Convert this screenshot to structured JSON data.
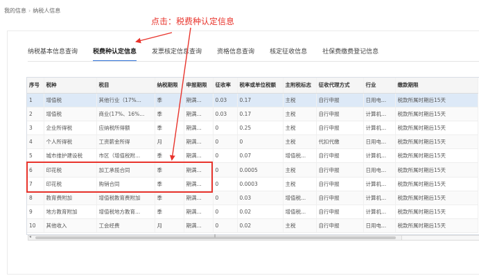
{
  "breadcrumb": {
    "root": "我的信息",
    "separator": "›",
    "current": "纳税人信息"
  },
  "annotation": {
    "text": "点击：税费种认定信息",
    "color": "#e8332b"
  },
  "tabs": [
    {
      "label": "纳税基本信息查询",
      "active": false
    },
    {
      "label": "税费种认定信息",
      "active": true
    },
    {
      "label": "发票核定信息查询",
      "active": false
    },
    {
      "label": "资格信息查询",
      "active": false
    },
    {
      "label": "核定征收信息",
      "active": false
    },
    {
      "label": "社保费缴费登记信息",
      "active": false
    }
  ],
  "table": {
    "headers": [
      "序号",
      "税种",
      "税目",
      "纳税期限",
      "申报期限",
      "征收率",
      "税率或单位税额",
      "主附税标志",
      "征收代理方式",
      "行业",
      "缴款期限"
    ],
    "rows": [
      [
        "1",
        "增值税",
        "其他行业（17%...",
        "季",
        "期满...",
        "0.03",
        "0.17",
        "主税",
        "自行申报",
        "日用电...",
        "税款所属时期后15天"
      ],
      [
        "2",
        "增值税",
        "商业(17%、16%...",
        "季",
        "期满...",
        "0.03",
        "0.17",
        "主税",
        "自行申报",
        "计算机...",
        "税款所属时期后15天"
      ],
      [
        "3",
        "企业所得税",
        "应纳税所得额",
        "季",
        "期满...",
        "0",
        "0.25",
        "主税",
        "自行申报",
        "计算机...",
        "税款所属时期后15天"
      ],
      [
        "4",
        "个人所得税",
        "工资薪金所得",
        "月",
        "期满...",
        "0",
        "0",
        "主税",
        "代扣代缴",
        "日用电...",
        "税款所属时期后15天"
      ],
      [
        "5",
        "城市维护建设税",
        "市区（增值税附...",
        "季",
        "期满...",
        "0",
        "0.07",
        "增值税...",
        "自行申报",
        "计算机...",
        "税款所属时期后15天"
      ],
      [
        "6",
        "印花税",
        "加工承揽合同",
        "季",
        "期满...",
        "0",
        "0.0005",
        "主税",
        "自行申报",
        "日用电...",
        "税款所属时期后15天"
      ],
      [
        "7",
        "印花税",
        "购销合同",
        "季",
        "期满...",
        "0",
        "0.0003",
        "主税",
        "自行申报",
        "计算机...",
        "税款所属时期后15天"
      ],
      [
        "8",
        "教育费附加",
        "增值税教育费附加",
        "季",
        "期满...",
        "0",
        "0.03",
        "增值税...",
        "自行申报",
        "计算机...",
        "税款所属时期后15天"
      ],
      [
        "9",
        "地方教育附加",
        "增值税地方教育...",
        "季",
        "期满...",
        "0",
        "0.02",
        "增值税...",
        "自行申报",
        "计算机...",
        "税款所属时期后15天"
      ],
      [
        "10",
        "其他收入",
        "工会经费",
        "月",
        "期满...",
        "0",
        "0.02",
        "主税",
        "自行申报",
        "日用电...",
        "税款所属时期后15天"
      ]
    ]
  },
  "scrollbar": {
    "left_arrow": "◂",
    "grip": "⦙⦙⦙"
  }
}
